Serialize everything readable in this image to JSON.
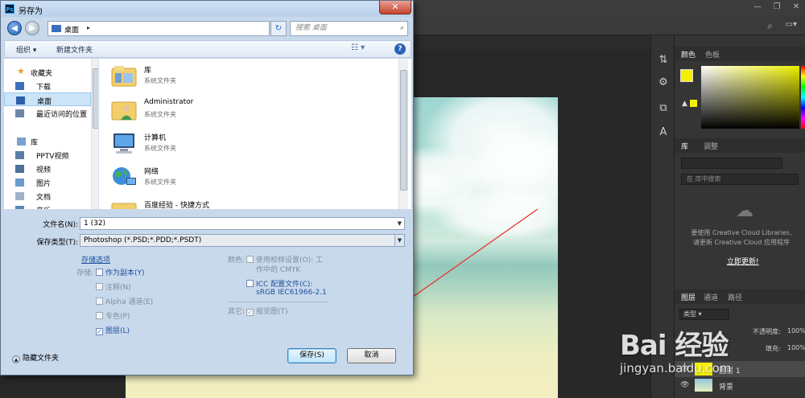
{
  "dialog": {
    "title": "另存为",
    "close_symbol": "✕",
    "address": {
      "location": "桌面",
      "separator": "▸",
      "dropdown": "▾"
    },
    "search_placeholder": "搜索 桌面",
    "toolbar": {
      "organize": "组织 ▾",
      "new_folder": "新建文件夹",
      "help": "?"
    },
    "nav": {
      "favorites_header": "收藏夹",
      "favorites": [
        "下载",
        "桌面",
        "最近访问的位置"
      ],
      "library_header": "库",
      "libraries": [
        "PPTV视频",
        "视频",
        "图片",
        "文档",
        "音乐"
      ]
    },
    "files": [
      {
        "name": "库",
        "type": "系统文件夹"
      },
      {
        "name": "Administrator",
        "type": "系统文件夹"
      },
      {
        "name": "计算机",
        "type": "系统文件夹"
      },
      {
        "name": "网络",
        "type": "系统文件夹"
      },
      {
        "name": "百度经验 - 快捷方式",
        "type": ""
      }
    ],
    "filename_label": "文件名(N):",
    "filename_value": "1 (32)",
    "filetype_label": "保存类型(T):",
    "filetype_value": "Photoshop (*.PSD;*.PDD;*.PSDT)",
    "storage_options_label": "存储选项",
    "storage_label": "存储:",
    "storage_options": [
      {
        "label": "作为副本(Y)",
        "checked": false,
        "enabled": true
      },
      {
        "label": "注释(N)",
        "checked": false,
        "enabled": false
      },
      {
        "label": "Alpha 通道(E)",
        "checked": false,
        "enabled": false
      },
      {
        "label": "专色(P)",
        "checked": false,
        "enabled": false
      },
      {
        "label": "图层(L)",
        "checked": true,
        "enabled": true
      }
    ],
    "color_label": "颜色:",
    "proof_setup_line1": "使用校样设置(O): 工",
    "proof_setup_line2": "作中的 CMYK",
    "icc_label": "ICC 配置文件(C):",
    "icc_profile": "sRGB IEC61966-2.1",
    "other_label": "其它:",
    "thumbnail_label": "缩览图(T)",
    "hide_folders": "隐藏文件夹",
    "save_button": "保存(S)",
    "cancel_button": "取消"
  },
  "photoshop": {
    "panels": {
      "color_tabs": [
        "颜色",
        "色板"
      ],
      "library_tabs": [
        "库",
        "调整"
      ],
      "library_search_placeholder": "在 库中搜索",
      "cc_message_line1": "要使用 Creative Cloud Libraries,",
      "cc_message_line2": "请更新 Creative Cloud 应用程序",
      "cc_link": "立即更新!",
      "layers_tabs": [
        "图层",
        "通道",
        "路径"
      ],
      "layers_filter": "类型",
      "opacity_label": "不透明度:",
      "opacity_value": "100%",
      "fill_label": "填充:",
      "fill_value": "100%",
      "layers": [
        {
          "name": "图层 1",
          "thumb_color": "#f5f000"
        },
        {
          "name": "背景",
          "thumb_color": "#8fc7d8"
        }
      ]
    },
    "window_buttons": [
      "—",
      "❐",
      "✕"
    ]
  },
  "watermark": {
    "brand": "Bai  经验",
    "site": "jingyan.baidu.com"
  },
  "colors": {
    "foreground": "#f5f000",
    "accent": "#2a63b7",
    "annotation_arrow": "#e8312a"
  }
}
